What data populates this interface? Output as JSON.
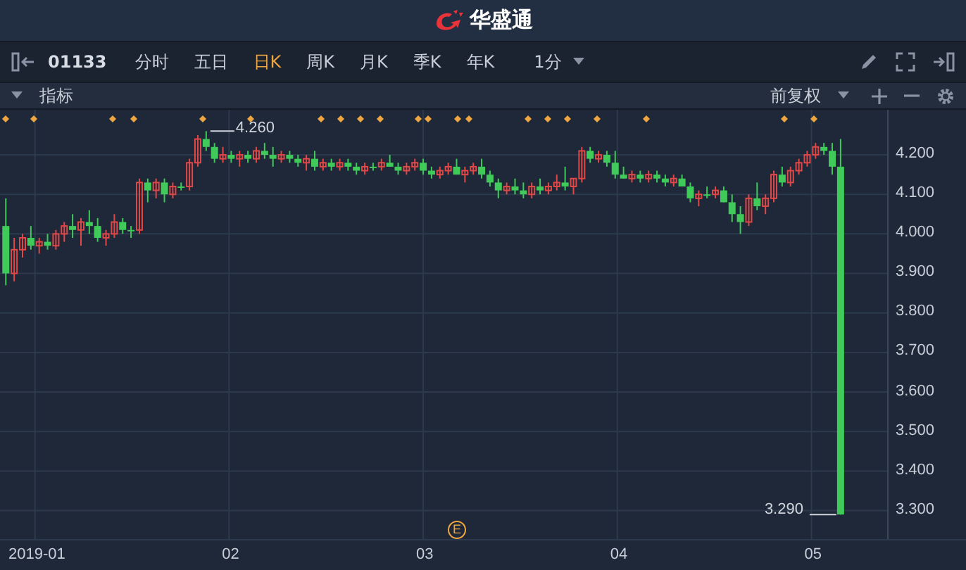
{
  "title_bar": {
    "brand": "华盛通"
  },
  "toolbar": {
    "symbol": "01133",
    "periods": [
      {
        "label": "分时",
        "selected": false
      },
      {
        "label": "五日",
        "selected": false
      },
      {
        "label": "日K",
        "selected": true
      },
      {
        "label": "周K",
        "selected": false
      },
      {
        "label": "月K",
        "selected": false
      },
      {
        "label": "季K",
        "selected": false
      },
      {
        "label": "年K",
        "selected": false
      }
    ],
    "interval": "1分"
  },
  "indicator_bar": {
    "label": "指标",
    "adjustment": "前复权"
  },
  "chart": {
    "event_marker": "E",
    "chart_data": {
      "type": "candlestick",
      "x": [
        0.85,
        0.893,
        0.936,
        0.979,
        1.022,
        1.065,
        1.108,
        1.151,
        1.194,
        1.237,
        1.28,
        1.323,
        1.366,
        1.409,
        1.452,
        1.495,
        1.538,
        1.581,
        1.624,
        1.667,
        1.71,
        1.753,
        1.796,
        1.839,
        1.882,
        1.925,
        1.968,
        2.011,
        2.054,
        2.097,
        2.14,
        2.183,
        2.226,
        2.269,
        2.312,
        2.355,
        2.398,
        2.441,
        2.484,
        2.527,
        2.57,
        2.613,
        2.656,
        2.699,
        2.742,
        2.785,
        2.828,
        2.871,
        2.914,
        2.957,
        3.0,
        3.043,
        3.086,
        3.129,
        3.172,
        3.215,
        3.258,
        3.301,
        3.344,
        3.387,
        3.43,
        3.473,
        3.516,
        3.559,
        3.602,
        3.645,
        3.688,
        3.731,
        3.774,
        3.817,
        3.86,
        3.903,
        3.946,
        3.989,
        4.032,
        4.075,
        4.118,
        4.161,
        4.204,
        4.247,
        4.29,
        4.333,
        4.376,
        4.419,
        4.462,
        4.505,
        4.548,
        4.591,
        4.634,
        4.677,
        4.72,
        4.763,
        4.806,
        4.849,
        4.892,
        4.935,
        4.978,
        5.021,
        5.064,
        5.107,
        5.15
      ],
      "xlim": [
        0.82,
        5.796
      ],
      "ylim": [
        3.228,
        4.314
      ],
      "grid": true,
      "ohlc": [
        [
          4.02,
          4.09,
          3.87,
          3.9
        ],
        [
          3.9,
          3.99,
          3.88,
          3.96
        ],
        [
          3.96,
          4.0,
          3.94,
          3.99
        ],
        [
          3.99,
          4.02,
          3.96,
          3.97
        ],
        [
          3.97,
          3.99,
          3.95,
          3.98
        ],
        [
          3.98,
          4.0,
          3.96,
          3.97
        ],
        [
          3.97,
          4.01,
          3.96,
          4.0
        ],
        [
          4.0,
          4.03,
          3.98,
          4.02
        ],
        [
          4.02,
          4.05,
          3.99,
          4.01
        ],
        [
          4.01,
          4.04,
          3.97,
          4.03
        ],
        [
          4.03,
          4.06,
          4.0,
          4.02
        ],
        [
          4.02,
          4.04,
          3.98,
          3.99
        ],
        [
          3.99,
          4.01,
          3.97,
          4.0
        ],
        [
          4.0,
          4.05,
          3.99,
          4.03
        ],
        [
          4.03,
          4.04,
          4.0,
          4.01
        ],
        [
          4.01,
          4.02,
          3.99,
          4.01
        ],
        [
          4.01,
          4.14,
          4.0,
          4.13
        ],
        [
          4.13,
          4.14,
          4.08,
          4.11
        ],
        [
          4.11,
          4.14,
          4.09,
          4.13
        ],
        [
          4.13,
          4.14,
          4.08,
          4.1
        ],
        [
          4.1,
          4.13,
          4.09,
          4.12
        ],
        [
          4.12,
          4.13,
          4.11,
          4.12
        ],
        [
          4.12,
          4.19,
          4.11,
          4.18
        ],
        [
          4.18,
          4.25,
          4.17,
          4.24
        ],
        [
          4.24,
          4.26,
          4.21,
          4.22
        ],
        [
          4.22,
          4.23,
          4.18,
          4.19
        ],
        [
          4.19,
          4.22,
          4.18,
          4.2
        ],
        [
          4.2,
          4.21,
          4.18,
          4.19
        ],
        [
          4.19,
          4.21,
          4.17,
          4.2
        ],
        [
          4.2,
          4.21,
          4.18,
          4.19
        ],
        [
          4.19,
          4.22,
          4.18,
          4.21
        ],
        [
          4.21,
          4.23,
          4.19,
          4.2
        ],
        [
          4.2,
          4.22,
          4.17,
          4.19
        ],
        [
          4.19,
          4.21,
          4.18,
          4.2
        ],
        [
          4.2,
          4.21,
          4.18,
          4.19
        ],
        [
          4.19,
          4.2,
          4.17,
          4.18
        ],
        [
          4.18,
          4.2,
          4.16,
          4.19
        ],
        [
          4.19,
          4.21,
          4.16,
          4.17
        ],
        [
          4.17,
          4.19,
          4.16,
          4.18
        ],
        [
          4.18,
          4.19,
          4.16,
          4.17
        ],
        [
          4.17,
          4.19,
          4.16,
          4.18
        ],
        [
          4.18,
          4.19,
          4.16,
          4.17
        ],
        [
          4.17,
          4.18,
          4.15,
          4.16
        ],
        [
          4.16,
          4.18,
          4.15,
          4.17
        ],
        [
          4.17,
          4.18,
          4.16,
          4.17
        ],
        [
          4.17,
          4.19,
          4.16,
          4.18
        ],
        [
          4.18,
          4.2,
          4.17,
          4.17
        ],
        [
          4.17,
          4.18,
          4.15,
          4.16
        ],
        [
          4.16,
          4.18,
          4.15,
          4.17
        ],
        [
          4.17,
          4.19,
          4.16,
          4.18
        ],
        [
          4.18,
          4.19,
          4.15,
          4.16
        ],
        [
          4.16,
          4.17,
          4.14,
          4.15
        ],
        [
          4.15,
          4.17,
          4.14,
          4.16
        ],
        [
          4.16,
          4.18,
          4.15,
          4.17
        ],
        [
          4.17,
          4.19,
          4.15,
          4.15
        ],
        [
          4.15,
          4.17,
          4.13,
          4.16
        ],
        [
          4.16,
          4.18,
          4.15,
          4.17
        ],
        [
          4.17,
          4.19,
          4.14,
          4.15
        ],
        [
          4.15,
          4.16,
          4.12,
          4.13
        ],
        [
          4.13,
          4.14,
          4.09,
          4.11
        ],
        [
          4.11,
          4.13,
          4.1,
          4.12
        ],
        [
          4.12,
          4.14,
          4.1,
          4.11
        ],
        [
          4.11,
          4.13,
          4.09,
          4.1
        ],
        [
          4.1,
          4.13,
          4.09,
          4.12
        ],
        [
          4.12,
          4.14,
          4.1,
          4.11
        ],
        [
          4.11,
          4.13,
          4.1,
          4.12
        ],
        [
          4.12,
          4.15,
          4.11,
          4.13
        ],
        [
          4.13,
          4.17,
          4.11,
          4.12
        ],
        [
          4.12,
          4.14,
          4.1,
          4.14
        ],
        [
          4.14,
          4.22,
          4.13,
          4.21
        ],
        [
          4.21,
          4.22,
          4.18,
          4.19
        ],
        [
          4.19,
          4.21,
          4.18,
          4.2
        ],
        [
          4.2,
          4.21,
          4.17,
          4.18
        ],
        [
          4.18,
          4.21,
          4.14,
          4.15
        ],
        [
          4.15,
          4.17,
          4.14,
          4.14
        ],
        [
          4.14,
          4.16,
          4.13,
          4.15
        ],
        [
          4.15,
          4.16,
          4.13,
          4.14
        ],
        [
          4.14,
          4.16,
          4.13,
          4.15
        ],
        [
          4.15,
          4.16,
          4.13,
          4.14
        ],
        [
          4.14,
          4.15,
          4.12,
          4.13
        ],
        [
          4.13,
          4.15,
          4.12,
          4.14
        ],
        [
          4.14,
          4.15,
          4.12,
          4.12
        ],
        [
          4.12,
          4.13,
          4.08,
          4.09
        ],
        [
          4.09,
          4.11,
          4.07,
          4.1
        ],
        [
          4.1,
          4.12,
          4.09,
          4.1
        ],
        [
          4.1,
          4.12,
          4.09,
          4.11
        ],
        [
          4.11,
          4.12,
          4.08,
          4.08
        ],
        [
          4.08,
          4.1,
          4.03,
          4.05
        ],
        [
          4.05,
          4.07,
          4.0,
          4.03
        ],
        [
          4.03,
          4.1,
          4.02,
          4.09
        ],
        [
          4.09,
          4.13,
          4.06,
          4.07
        ],
        [
          4.07,
          4.1,
          4.05,
          4.09
        ],
        [
          4.09,
          4.16,
          4.08,
          4.15
        ],
        [
          4.15,
          4.17,
          4.12,
          4.13
        ],
        [
          4.13,
          4.17,
          4.12,
          4.16
        ],
        [
          4.16,
          4.19,
          4.15,
          4.18
        ],
        [
          4.18,
          4.21,
          4.17,
          4.2
        ],
        [
          4.2,
          4.23,
          4.19,
          4.22
        ],
        [
          4.22,
          4.23,
          4.2,
          4.21
        ],
        [
          4.21,
          4.23,
          4.15,
          4.17
        ],
        [
          4.17,
          4.24,
          3.29,
          3.29
        ]
      ],
      "xticks": [
        {
          "value": 1,
          "label": "2019-01"
        },
        {
          "value": 2,
          "label": "02"
        },
        {
          "value": 3,
          "label": "03"
        },
        {
          "value": 4,
          "label": "04"
        },
        {
          "value": 5,
          "label": "05"
        }
      ],
      "yticks": [
        {
          "value": 4.2,
          "label": "4.200"
        },
        {
          "value": 4.1,
          "label": "4.100"
        },
        {
          "value": 4.0,
          "label": "4.000"
        },
        {
          "value": 3.9,
          "label": "3.900"
        },
        {
          "value": 3.8,
          "label": "3.800"
        },
        {
          "value": 3.7,
          "label": "3.700"
        },
        {
          "value": 3.6,
          "label": "3.600"
        },
        {
          "value": 3.5,
          "label": "3.500"
        },
        {
          "value": 3.4,
          "label": "3.400"
        },
        {
          "value": 3.3,
          "label": "3.300"
        }
      ],
      "annotations": [
        "4.260",
        "3.290"
      ]
    }
  }
}
